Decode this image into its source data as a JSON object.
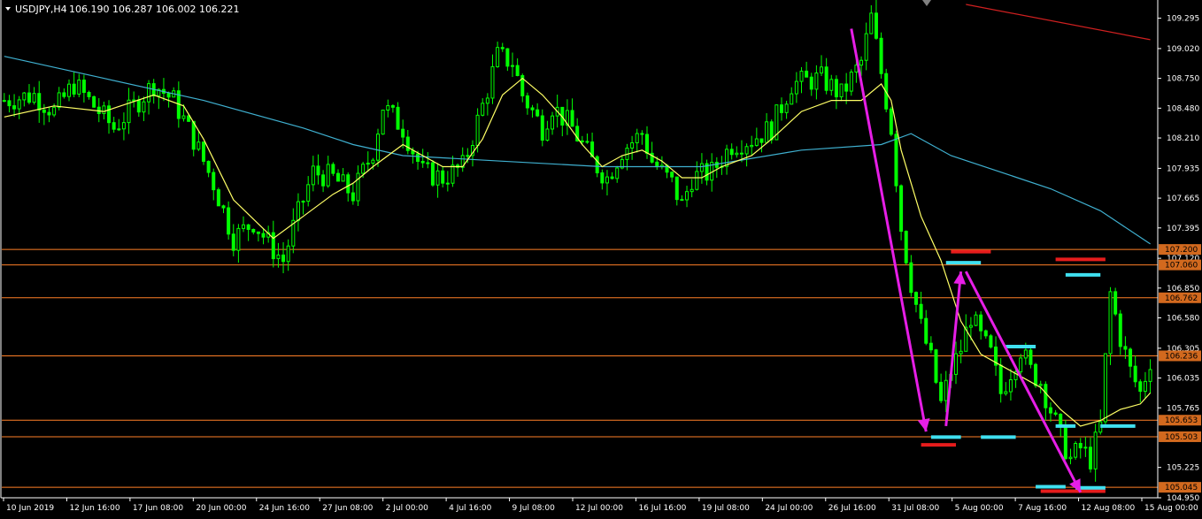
{
  "header": {
    "title": "USDJPY,H4",
    "ohlc": "106.190 106.287 106.002 106.221"
  },
  "colors": {
    "background": "#000000",
    "candle": "#00ff00",
    "ma_fast": "#ffff66",
    "ma_slow": "#3fb0d0",
    "ma_long": "#d02020",
    "hline": "#ff7f27",
    "price_box": "#d2691e",
    "arrow": "#e61ee6",
    "marker_red": "#e61c1c",
    "marker_cyan": "#3fe0f0",
    "axis": "#ffffff"
  },
  "chart_data": {
    "type": "candlestick",
    "symbol": "USDJPY",
    "timeframe": "H4",
    "ylim": [
      104.95,
      109.42
    ],
    "x_tick_labels": [
      "10 Jun 2019",
      "12 Jun 16:00",
      "17 Jun 08:00",
      "20 Jun 00:00",
      "24 Jun 16:00",
      "27 Jun 08:00",
      "2 Jul 00:00",
      "4 Jul 16:00",
      "9 Jul 08:00",
      "12 Jul 00:00",
      "16 Jul 16:00",
      "19 Jul 08:00",
      "24 Jul 00:00",
      "26 Jul 16:00",
      "31 Jul 08:00",
      "5 Aug 00:00",
      "7 Aug 16:00",
      "12 Aug 08:00",
      "15 Aug 00:00"
    ],
    "y_ticks": [
      "109.295",
      "109.020",
      "108.750",
      "108.480",
      "108.210",
      "107.935",
      "107.665",
      "107.395",
      "107.120",
      "106.850",
      "106.580",
      "106.305",
      "106.035",
      "105.765",
      "105.225",
      "104.950"
    ],
    "price_levels": [
      "107.200",
      "107.060",
      "106.762",
      "106.236",
      "105.653",
      "105.503",
      "105.045"
    ],
    "close_path": [
      [
        0,
        108.55
      ],
      [
        6,
        108.6
      ],
      [
        10,
        108.45
      ],
      [
        14,
        108.7
      ],
      [
        18,
        108.5
      ],
      [
        22,
        108.3
      ],
      [
        26,
        108.5
      ],
      [
        30,
        108.7
      ],
      [
        34,
        108.55
      ],
      [
        38,
        108.2
      ],
      [
        42,
        107.8
      ],
      [
        46,
        107.3
      ],
      [
        50,
        107.45
      ],
      [
        54,
        107.2
      ],
      [
        56,
        107.1
      ],
      [
        58,
        107.4
      ],
      [
        62,
        107.9
      ],
      [
        66,
        107.85
      ],
      [
        70,
        107.7
      ],
      [
        74,
        108.1
      ],
      [
        76,
        108.5
      ],
      [
        80,
        108.3
      ],
      [
        84,
        107.9
      ],
      [
        88,
        107.85
      ],
      [
        92,
        107.95
      ],
      [
        96,
        108.5
      ],
      [
        99,
        108.95
      ],
      [
        102,
        108.9
      ],
      [
        104,
        108.6
      ],
      [
        108,
        108.3
      ],
      [
        110,
        108.5
      ],
      [
        114,
        108.3
      ],
      [
        118,
        108.0
      ],
      [
        121,
        107.85
      ],
      [
        124,
        108.1
      ],
      [
        128,
        108.25
      ],
      [
        130,
        108.0
      ],
      [
        134,
        107.8
      ],
      [
        136,
        107.6
      ],
      [
        138,
        107.85
      ],
      [
        142,
        107.9
      ],
      [
        146,
        108.15
      ],
      [
        150,
        108.2
      ],
      [
        154,
        108.3
      ],
      [
        158,
        108.7
      ],
      [
        164,
        108.75
      ],
      [
        168,
        108.6
      ],
      [
        172,
        108.9
      ],
      [
        174,
        109.3
      ],
      [
        176,
        108.8
      ],
      [
        178,
        108.3
      ],
      [
        180,
        107.4
      ],
      [
        182,
        106.9
      ],
      [
        184,
        106.5
      ],
      [
        186,
        106.2
      ],
      [
        188,
        105.8
      ],
      [
        190,
        106.1
      ],
      [
        192,
        106.3
      ],
      [
        194,
        106.6
      ],
      [
        196,
        106.4
      ],
      [
        198,
        106.25
      ],
      [
        200,
        105.9
      ],
      [
        204,
        106.3
      ],
      [
        206,
        106.1
      ],
      [
        208,
        106.0
      ],
      [
        210,
        105.75
      ],
      [
        212,
        105.5
      ],
      [
        214,
        105.3
      ],
      [
        216,
        105.4
      ],
      [
        218,
        105.3
      ],
      [
        220,
        105.6
      ],
      [
        222,
        106.8
      ],
      [
        224,
        106.4
      ],
      [
        226,
        106.1
      ],
      [
        228,
        105.9
      ],
      [
        230,
        106.2
      ]
    ],
    "ma_fast": [
      [
        0,
        108.4
      ],
      [
        10,
        108.5
      ],
      [
        20,
        108.45
      ],
      [
        30,
        108.6
      ],
      [
        36,
        108.5
      ],
      [
        40,
        108.2
      ],
      [
        46,
        107.65
      ],
      [
        54,
        107.3
      ],
      [
        60,
        107.5
      ],
      [
        66,
        107.7
      ],
      [
        70,
        107.8
      ],
      [
        74,
        107.95
      ],
      [
        80,
        108.15
      ],
      [
        84,
        108.05
      ],
      [
        88,
        107.95
      ],
      [
        92,
        107.95
      ],
      [
        96,
        108.2
      ],
      [
        100,
        108.6
      ],
      [
        104,
        108.75
      ],
      [
        108,
        108.6
      ],
      [
        112,
        108.4
      ],
      [
        116,
        108.15
      ],
      [
        120,
        107.95
      ],
      [
        124,
        108.05
      ],
      [
        128,
        108.1
      ],
      [
        132,
        108.0
      ],
      [
        136,
        107.85
      ],
      [
        140,
        107.85
      ],
      [
        144,
        107.95
      ],
      [
        150,
        108.05
      ],
      [
        154,
        108.2
      ],
      [
        160,
        108.45
      ],
      [
        166,
        108.55
      ],
      [
        172,
        108.55
      ],
      [
        176,
        108.7
      ],
      [
        178,
        108.55
      ],
      [
        180,
        108.1
      ],
      [
        184,
        107.5
      ],
      [
        188,
        107.1
      ],
      [
        192,
        106.55
      ],
      [
        196,
        106.25
      ],
      [
        200,
        106.15
      ],
      [
        204,
        106.05
      ],
      [
        208,
        105.95
      ],
      [
        212,
        105.75
      ],
      [
        216,
        105.6
      ],
      [
        220,
        105.65
      ],
      [
        224,
        105.75
      ],
      [
        228,
        105.8
      ],
      [
        230,
        105.9
      ]
    ],
    "ma_slow": [
      [
        0,
        108.95
      ],
      [
        20,
        108.75
      ],
      [
        40,
        108.55
      ],
      [
        60,
        108.3
      ],
      [
        70,
        108.15
      ],
      [
        80,
        108.05
      ],
      [
        100,
        108.0
      ],
      [
        120,
        107.95
      ],
      [
        140,
        107.95
      ],
      [
        160,
        108.1
      ],
      [
        176,
        108.15
      ],
      [
        182,
        108.25
      ],
      [
        190,
        108.05
      ],
      [
        200,
        107.9
      ],
      [
        210,
        107.75
      ],
      [
        220,
        107.55
      ],
      [
        230,
        107.25
      ]
    ],
    "ma_long": [
      [
        193,
        109.42
      ],
      [
        230,
        109.1
      ]
    ],
    "arrows": [
      {
        "from": [
          170,
          109.2
        ],
        "to": [
          185,
          105.55
        ]
      },
      {
        "from": [
          189,
          105.6
        ],
        "to": [
          192,
          107.0
        ]
      },
      {
        "from": [
          193,
          107.0
        ],
        "to": [
          216,
          105.0
        ]
      }
    ],
    "red_markers": [
      {
        "x1": 170,
        "x2": 183,
        "y": 109.48
      },
      {
        "x1": 190,
        "x2": 198,
        "y": 107.18
      },
      {
        "x1": 184,
        "x2": 191,
        "y": 105.43
      },
      {
        "x1": 211,
        "x2": 221,
        "y": 107.11
      },
      {
        "x1": 208,
        "x2": 221,
        "y": 105.01
      }
    ],
    "cyan_markers": [
      {
        "x1": 189,
        "x2": 196,
        "y": 107.08
      },
      {
        "x1": 213,
        "x2": 220,
        "y": 106.97
      },
      {
        "x1": 186,
        "x2": 192,
        "y": 105.5
      },
      {
        "x1": 196,
        "x2": 203,
        "y": 105.5
      },
      {
        "x1": 201,
        "x2": 207,
        "y": 106.32
      },
      {
        "x1": 211,
        "x2": 215,
        "y": 105.6
      },
      {
        "x1": 220,
        "x2": 227,
        "y": 105.6
      },
      {
        "x1": 207,
        "x2": 213,
        "y": 105.05
      },
      {
        "x1": 215,
        "x2": 221,
        "y": 105.04
      }
    ]
  }
}
